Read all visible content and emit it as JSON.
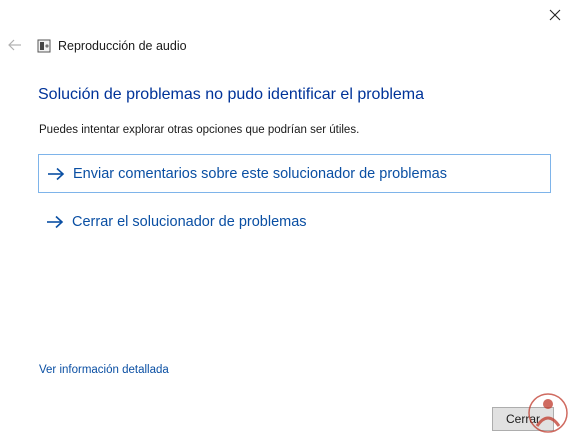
{
  "window": {
    "title": "Reproducción de audio"
  },
  "main": {
    "heading": "Solución de problemas no pudo identificar el problema",
    "subtext": "Puedes intentar explorar otras opciones que podrían ser útiles.",
    "options": [
      {
        "label": "Enviar comentarios sobre este solucionador de problemas"
      },
      {
        "label": "Cerrar el solucionador de problemas"
      }
    ],
    "details_link": "Ver información detallada"
  },
  "footer": {
    "close_label": "Cerrar"
  },
  "icons": {
    "close": "close-icon",
    "back": "back-arrow-icon",
    "app": "speaker-icon",
    "option_arrow": "right-arrow-icon"
  },
  "colors": {
    "heading": "#003399",
    "link": "#0a4fa3",
    "selected_border": "#7eb4ea"
  }
}
